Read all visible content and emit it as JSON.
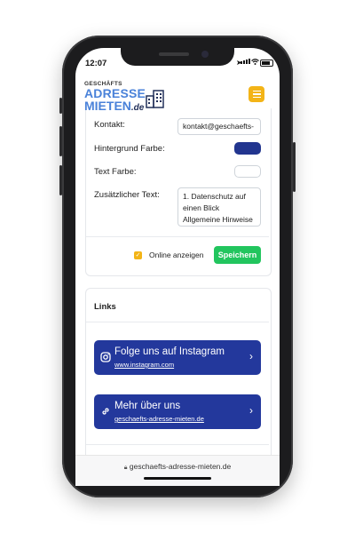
{
  "status": {
    "time": "12:07"
  },
  "logo": {
    "line1": "GESCHÄFTS",
    "line2": "ADRESSE",
    "line3": "MIETEN",
    "tld": ".de"
  },
  "form": {
    "kontakt_label": "Kontakt:",
    "kontakt_value": "kontakt@geschaefts-",
    "bg_color_label": "Hintergrund Farbe:",
    "bg_color_value": "#22358f",
    "text_color_label": "Text Farbe:",
    "text_color_value": "#ffffff",
    "extra_text_label": "Zusätzlicher Text:",
    "extra_text_lines": [
      "1. Datenschutz auf",
      "einen Blick",
      "Allgemeine Hinweise"
    ],
    "online_label": "Online anzeigen",
    "online_checked": true,
    "save_label": "Speichern"
  },
  "links": {
    "section_title": "Links",
    "items": [
      {
        "title": "Folge uns auf Instagram",
        "url": "www.instagram.com",
        "icon": "instagram-icon"
      },
      {
        "title": "Mehr über uns",
        "url": "geschaefts-adresse-mieten.de",
        "icon": "link-icon"
      }
    ]
  },
  "browser": {
    "url": "geschaefts-adresse-mieten.de"
  },
  "colors": {
    "accent": "#f3b417",
    "primary": "#23389c",
    "success": "#22c55e",
    "brand": "#4a82d9"
  }
}
